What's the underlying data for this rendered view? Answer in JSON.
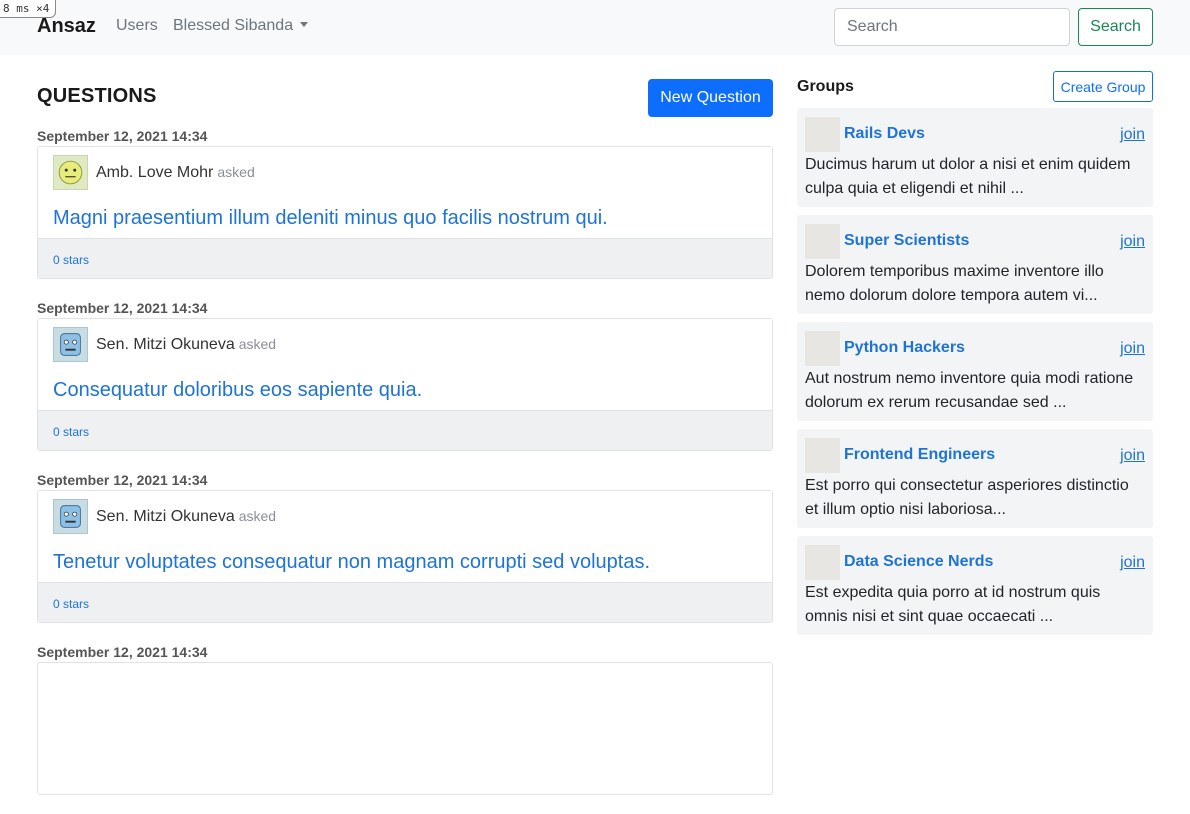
{
  "debug": {
    "label": "8 ms ×4"
  },
  "navbar": {
    "brand": "Ansaz",
    "users_link": "Users",
    "user_menu": "Blessed Sibanda",
    "search_placeholder": "Search",
    "search_button": "Search"
  },
  "questions": {
    "heading": "QUESTIONS",
    "new_button": "New Question",
    "asked_label": "asked",
    "items": [
      {
        "date": "September 12, 2021 14:34",
        "author": "Amb. Love Mohr",
        "avatar": "green-face-icon",
        "title": "Magni praesentium illum deleniti minus quo facilis nostrum qui.",
        "stars": "0 stars"
      },
      {
        "date": "September 12, 2021 14:34",
        "author": "Sen. Mitzi Okuneva",
        "avatar": "blue-robot-icon",
        "title": "Consequatur doloribus eos sapiente quia.",
        "stars": "0 stars"
      },
      {
        "date": "September 12, 2021 14:34",
        "author": "Sen. Mitzi Okuneva",
        "avatar": "blue-robot-icon",
        "title": "Tenetur voluptates consequatur non magnam corrupti sed voluptas.",
        "stars": "0 stars"
      },
      {
        "date": "September 12, 2021 14:34"
      }
    ]
  },
  "groups": {
    "heading": "Groups",
    "create_button": "Create Group",
    "join_label": "join",
    "items": [
      {
        "name": "Rails Devs",
        "description": "Ducimus harum ut dolor a nisi et enim quidem culpa quia et eligendi et nihil ..."
      },
      {
        "name": "Super Scientists",
        "description": "Dolorem temporibus maxime inventore illo nemo dolorum dolore tempora autem vi..."
      },
      {
        "name": "Python Hackers",
        "description": "Aut nostrum nemo inventore quia modi ratione dolorum ex rerum recusandae sed ..."
      },
      {
        "name": "Frontend Engineers",
        "description": "Est porro qui consectetur asperiores distinctio et illum optio nisi laboriosa..."
      },
      {
        "name": "Data Science Nerds",
        "description": "Est expedita quia porro at id nostrum quis omnis nisi et sint quae occaecati ..."
      }
    ]
  },
  "colors": {
    "primary": "#0d6efd",
    "success": "#198754",
    "link": "#1e73d8",
    "navbar_bg": "#f8f9fa"
  }
}
